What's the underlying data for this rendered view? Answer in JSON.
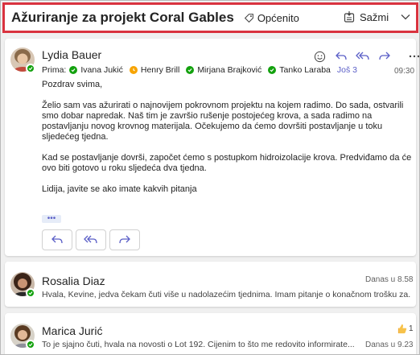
{
  "header": {
    "subject": "Ažuriranje za projekt Coral Gables",
    "category": "Općenito",
    "collapse_label": "Sažmi"
  },
  "message1": {
    "sender": "Lydia Bauer",
    "to_label": "Prima:",
    "recipients": [
      {
        "name": "Ivana Jukić",
        "status": "available"
      },
      {
        "name": "Henry Brill",
        "status": "away"
      },
      {
        "name": "Mirjana Brajković",
        "status": "available"
      },
      {
        "name": "Tanko Laraba",
        "status": "available"
      }
    ],
    "more_recipients": "Još 3",
    "time": "09:30",
    "body": [
      "Pozdrav svima,",
      "Želio sam vas ažurirati o najnovijem pokrovnom projektu na kojem radimo. Do sada, ostvarili smo dobar napredak. Naš tim je završio rušenje postojećeg krova, a sada radimo na postavljanju novog krovnog materijala. Očekujemo da ćemo dovršiti postavljanje u toku sljedećeg tjedna.",
      "Kad se postavljanje dovrši, započet ćemo s postupkom hidroizolacije krova. Predviđamo da će ovo biti gotovo u roku sljedeća dva tjedna.",
      "Lidija, javite se ako imate kakvih pitanja"
    ],
    "ellipsis": "•••"
  },
  "message2": {
    "sender": "Rosalia Diaz",
    "time": "Danas u 8.58",
    "preview": "Hvala, Kevine, jedva čekam čuti više u nadolazećim tjednima. Imam pitanje o konačnom trošku za..."
  },
  "message3": {
    "sender": "Marica Jurić",
    "time": "Danas u 9.23",
    "reaction_count": "1",
    "preview": "To je sjajno čuti, hvala na novosti o Lot 192. Cijenim to što me redovito informirate..."
  },
  "colors": {
    "accent": "#5b5fc7",
    "highlight_border": "#d9333f",
    "available": "#13a10e",
    "away": "#f7a400"
  }
}
